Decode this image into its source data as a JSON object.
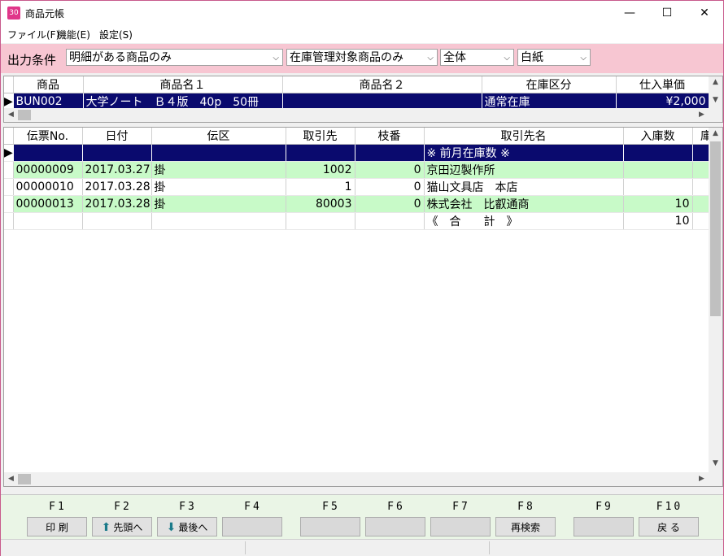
{
  "window": {
    "title": "商品元帳",
    "icon_text": "30",
    "minimize": "—",
    "maximize": "☐",
    "close": "✕"
  },
  "menu": [
    "ファイル(F)",
    "機能(E)",
    "設定(S)"
  ],
  "conditions": {
    "label": "出力条件",
    "combos": [
      "明細がある商品のみ",
      "在庫管理対象商品のみ",
      "全体",
      "白紙"
    ]
  },
  "product_grid": {
    "headers": [
      "商品",
      "商品名１",
      "商品名２",
      "在庫区分",
      "仕入単価"
    ],
    "rows": [
      [
        "BUN002",
        "大学ノート　Ｂ４版　40p　50冊",
        "",
        "通常在庫",
        "¥2,000"
      ]
    ]
  },
  "ledger_grid": {
    "headers": [
      "伝票No.",
      "日付",
      "伝区",
      "取引先",
      "枝番",
      "取引先名",
      "入庫数",
      "庫"
    ],
    "rows": [
      {
        "cells": [
          "",
          "",
          "",
          "",
          "",
          "※ 前月在庫数 ※",
          "",
          ""
        ],
        "style": "sel"
      },
      {
        "cells": [
          "00000009",
          "2017.03.27",
          "掛",
          "1002",
          "0",
          "京田辺製作所",
          "",
          ""
        ],
        "style": "green"
      },
      {
        "cells": [
          "00000010",
          "2017.03.28",
          "掛",
          "1",
          "0",
          "猫山文具店　本店",
          "",
          ""
        ],
        "style": ""
      },
      {
        "cells": [
          "00000013",
          "2017.03.28",
          "掛",
          "80003",
          "0",
          "株式会社　比叡通商",
          "10",
          ""
        ],
        "style": "green"
      },
      {
        "cells": [
          "",
          "",
          "",
          "",
          "",
          "《　合　　計　》",
          "10",
          ""
        ],
        "style": ""
      }
    ]
  },
  "fkeys": [
    {
      "key": "F1",
      "label": "印 刷"
    },
    {
      "key": "F2",
      "label": "先頭へ",
      "icon": "up-arrow-icon"
    },
    {
      "key": "F3",
      "label": "最後へ",
      "icon": "down-arrow-icon"
    },
    {
      "key": "F4",
      "label": ""
    },
    {
      "key": "F5",
      "label": ""
    },
    {
      "key": "F6",
      "label": ""
    },
    {
      "key": "F7",
      "label": ""
    },
    {
      "key": "F8",
      "label": "再検索"
    },
    {
      "key": "F9",
      "label": ""
    },
    {
      "key": "F10",
      "label": "戻 る"
    }
  ],
  "colors": {
    "selection": "#0a0a6e",
    "alt_row": "#c8fac8",
    "cond_bar": "#f7c6d2",
    "fkey_bar": "#eaf5e6",
    "arrow_icon": "#1a7a8a"
  }
}
